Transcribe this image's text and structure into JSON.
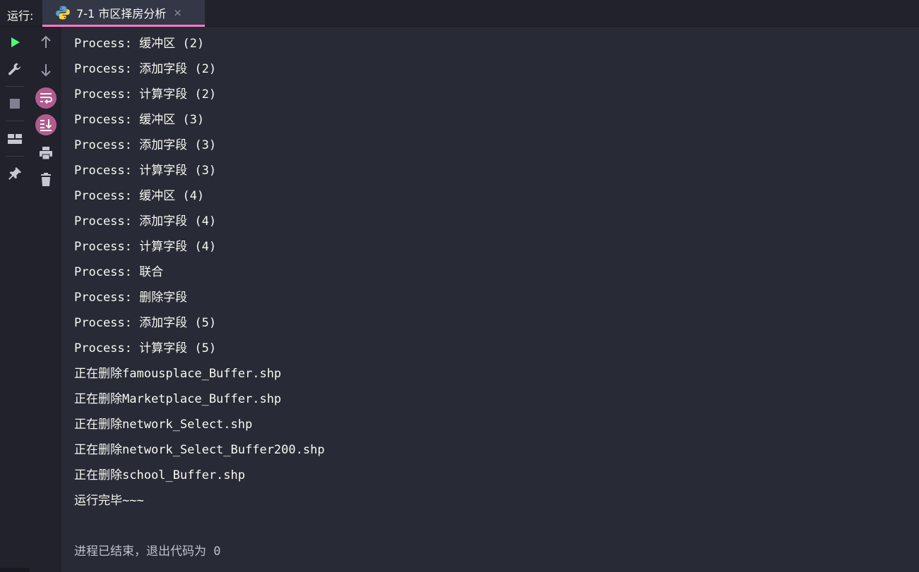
{
  "header": {
    "run_label": "运行:",
    "tab": {
      "title": "7-1 市区择房分析",
      "close": "×",
      "icon": "python-icon"
    }
  },
  "toolbar": {
    "primary": [
      "run-icon",
      "wrench-icon",
      "stop-icon",
      "layout-icon",
      "pin-icon"
    ],
    "secondary": [
      "arrow-up-icon",
      "arrow-down-icon",
      "soft-wrap-icon",
      "scroll-to-end-icon",
      "print-icon",
      "trash-icon"
    ]
  },
  "colors": {
    "accent": "#ff79c6",
    "run": "#50fa7b",
    "badge": "#b15c8f",
    "background": "#282a36",
    "sidebar": "#21222c",
    "text": "#f8f8f2"
  },
  "console": {
    "lines": [
      "Process: 缓冲区 (2)",
      "Process: 添加字段 (2)",
      "Process: 计算字段 (2)",
      "Process: 缓冲区 (3)",
      "Process: 添加字段 (3)",
      "Process: 计算字段 (3)",
      "Process: 缓冲区 (4)",
      "Process: 添加字段 (4)",
      "Process: 计算字段 (4)",
      "Process: 联合",
      "Process: 删除字段",
      "Process: 添加字段 (5)",
      "Process: 计算字段 (5)",
      "正在删除famousplace_Buffer.shp",
      "正在删除Marketplace_Buffer.shp",
      "正在删除network_Select.shp",
      "正在删除network_Select_Buffer200.shp",
      "正在删除school_Buffer.shp",
      "运行完毕~~~"
    ],
    "exit_message": "进程已结束，退出代码为 0"
  }
}
